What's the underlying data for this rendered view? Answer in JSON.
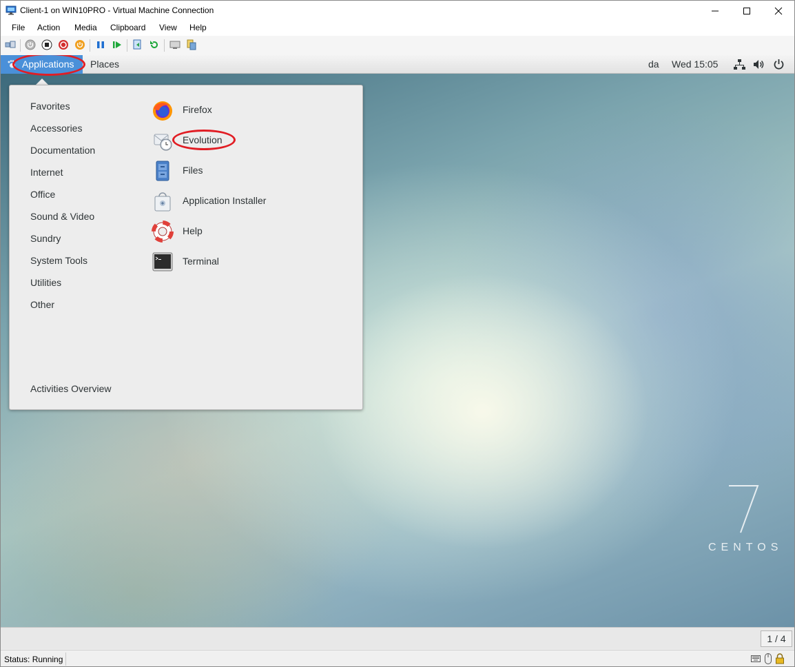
{
  "window": {
    "title": "Client-1 on WIN10PRO - Virtual Machine Connection",
    "controls": [
      "minimize",
      "maximize",
      "close"
    ]
  },
  "menubar": {
    "items": [
      {
        "label": "File"
      },
      {
        "label": "Action"
      },
      {
        "label": "Media"
      },
      {
        "label": "Clipboard"
      },
      {
        "label": "View"
      },
      {
        "label": "Help"
      }
    ]
  },
  "toolbar": {
    "icons": [
      "ctrl-alt-del-icon",
      "start-icon",
      "turn-off-icon",
      "shut-down-icon",
      "save-icon",
      "pause-icon",
      "resume-icon",
      "checkpoint-icon",
      "revert-icon",
      "enhanced-session-icon",
      "share-icon"
    ]
  },
  "guest": {
    "topbar": {
      "applications": "Applications",
      "places": "Places",
      "keyboard_layout": "da",
      "clock": "Wed 15:05"
    },
    "app_menu": {
      "categories": [
        {
          "label": "Favorites"
        },
        {
          "label": "Accessories"
        },
        {
          "label": "Documentation"
        },
        {
          "label": "Internet"
        },
        {
          "label": "Office"
        },
        {
          "label": "Sound & Video"
        },
        {
          "label": "Sundry"
        },
        {
          "label": "System Tools"
        },
        {
          "label": "Utilities"
        },
        {
          "label": "Other"
        }
      ],
      "activities": "Activities Overview",
      "apps": [
        {
          "label": "Firefox",
          "icon": "firefox-icon"
        },
        {
          "label": "Evolution",
          "icon": "evolution-icon"
        },
        {
          "label": "Files",
          "icon": "files-icon"
        },
        {
          "label": "Application Installer",
          "icon": "app-installer-icon"
        },
        {
          "label": "Help",
          "icon": "help-lifebuoy-icon"
        },
        {
          "label": "Terminal",
          "icon": "terminal-icon"
        }
      ]
    },
    "logo": {
      "number": "7",
      "text": "CENTOS"
    },
    "workspace": "1 / 4"
  },
  "statusbar": {
    "status": "Status: Running"
  },
  "colors": {
    "highlight": "#4a90d9",
    "annotation": "#e11d24"
  }
}
